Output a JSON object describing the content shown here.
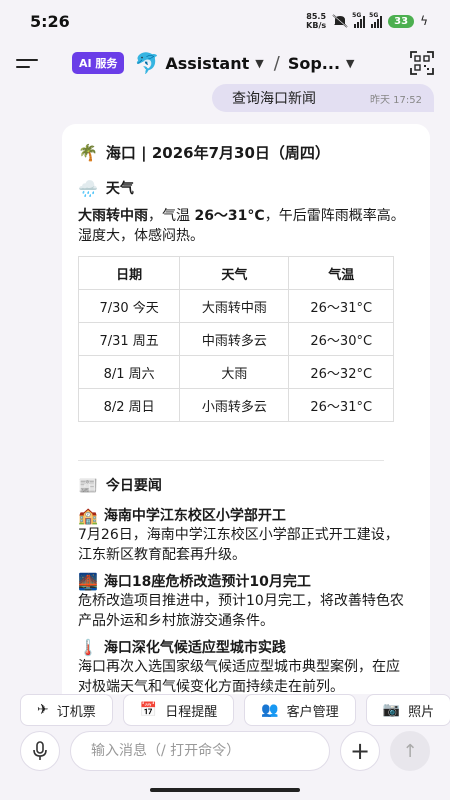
{
  "status": {
    "time": "5:26",
    "speed_value": "85.5",
    "speed_unit": "KB/s",
    "net1": "5G",
    "net2": "5G",
    "battery": "33"
  },
  "nav": {
    "badge": "AI 服务",
    "title": "Assistant",
    "subtitle": "Sop...",
    "slash": "/"
  },
  "user_message": {
    "text": "查询海口新闻",
    "timestamp": "昨天 17:52"
  },
  "card": {
    "heading": "海口 | 2026年7月30日（周四）",
    "weather": {
      "section_title": "天气",
      "summary_bold1": "大雨转中雨",
      "summary_mid": "，气温 ",
      "summary_bold2": "26～31°C",
      "summary_tail": "，午后雷阵雨概率高。湿度大，体感闷热。",
      "headers": [
        "日期",
        "天气",
        "气温"
      ],
      "rows": [
        [
          "7/30 今天",
          "大雨转中雨",
          "26～31°C"
        ],
        [
          "7/31 周五",
          "中雨转多云",
          "26～30°C"
        ],
        [
          "8/1 周六",
          "大雨",
          "26～32°C"
        ],
        [
          "8/2 周日",
          "小雨转多云",
          "26～31°C"
        ]
      ]
    },
    "news": {
      "section_title": "今日要闻",
      "items": [
        {
          "title": "海南中学江东校区小学部开工",
          "body": "7月26日，海南中学江东校区小学部正式开工建设，江东新区教育配套再升级。"
        },
        {
          "title": "海口18座危桥改造预计10月完工",
          "body": "危桥改造项目推进中，预计10月完工，将改善特色农产品外运和乡村旅游交通条件。"
        },
        {
          "title": "海口深化气候适应型城市实践",
          "body": "海口再次入选国家级气候适应型城市典型案例，在应对极端天气和气候变化方面持续走在前列。"
        }
      ]
    }
  },
  "chips": [
    "订机票",
    "日程提醒",
    "客户管理",
    "照片"
  ],
  "input": {
    "placeholder": "输入消息（/ 打开命令）"
  },
  "colors": {
    "accent": "#6a3de8",
    "bubble": "#e3dff2",
    "background": "#f5f3f8"
  }
}
